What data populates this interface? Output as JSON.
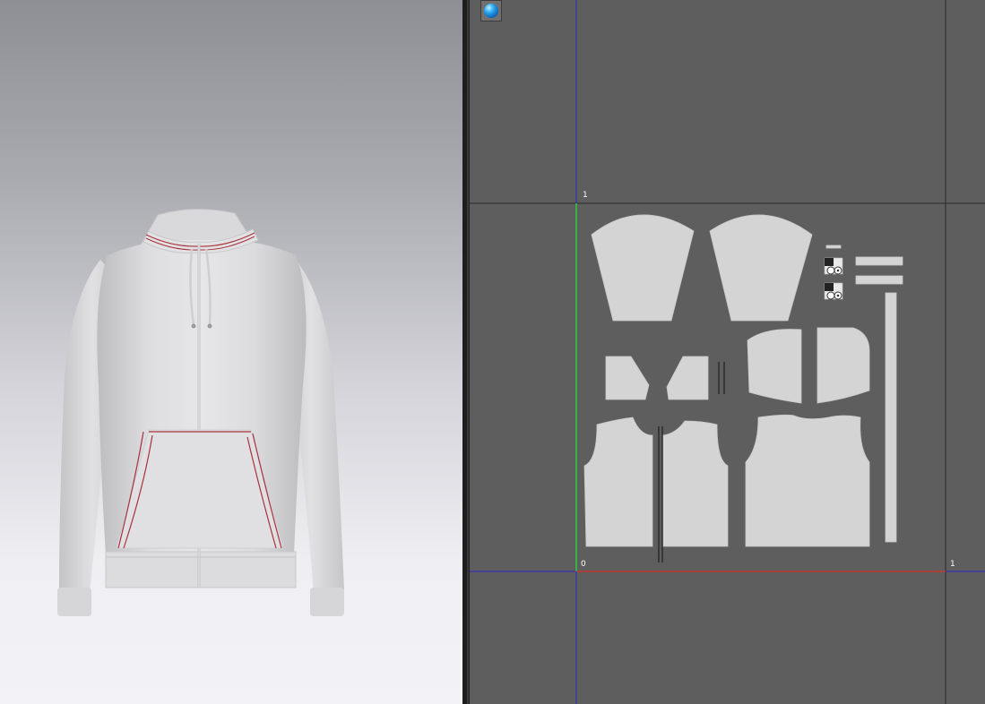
{
  "viewport_3d": {
    "garment": "hoodie",
    "background_top": "#8e8f95",
    "background_bottom": "#f3f3f7"
  },
  "viewport_2d": {
    "background": "#5e5e5e",
    "tools": [
      {
        "name": "sphere-display-toggle",
        "icon": "blue-sphere-icon"
      }
    ],
    "uv_labels": {
      "top_left": "1",
      "origin": "0",
      "bottom_right": "1"
    },
    "axis_colors": {
      "u_axis": "#c0392b",
      "v_axis": "#2ecc40",
      "guides": "#2828c8",
      "frame": "#2a2a2a"
    }
  }
}
